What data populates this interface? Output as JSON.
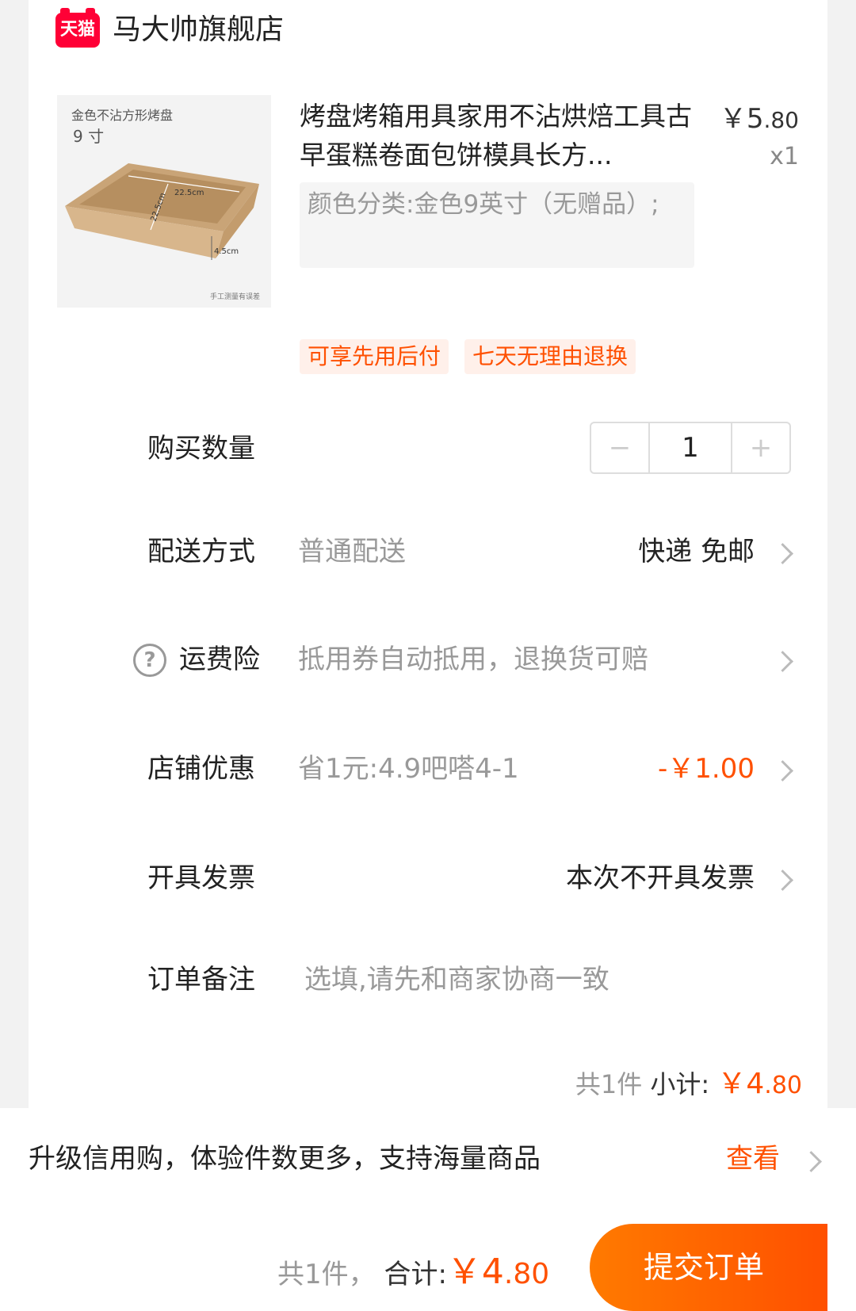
{
  "shop": {
    "logo_text": "天猫",
    "name": "马大帅旗舰店"
  },
  "product": {
    "image_caption": "金色不沾方形烤盘",
    "image_size_label": "9 寸",
    "image_dim_width": "22.5cm",
    "image_dim_depth": "22.5cm",
    "image_dim_height": "4.5cm",
    "image_note": "手工测量有误差",
    "title": "烤盘烤箱用具家用不沾烘焙工具古早蛋糕卷面包饼模具长方...",
    "price_symbol": "￥",
    "price_int": "5",
    "price_dec": ".80",
    "quantity_text": "x1",
    "sku": "颜色分类:金色9英寸（无赠品）;",
    "tags": [
      "可享先用后付",
      "七天无理由退换"
    ]
  },
  "rows": {
    "quantity": {
      "label": "购买数量",
      "value": "1",
      "minus": "−",
      "plus": "+"
    },
    "delivery": {
      "label": "配送方式",
      "method": "普通配送",
      "value": "快递 免邮"
    },
    "insurance": {
      "label": "运费险",
      "value": "抵用券自动抵用，退换货可赔",
      "help": "?"
    },
    "discount": {
      "label": "店铺优惠",
      "desc": "省1元:4.9吧嗒4-1",
      "value": "-￥1.00"
    },
    "invoice": {
      "label": "开具发票",
      "value": "本次不开具发票"
    },
    "note": {
      "label": "订单备注",
      "placeholder": "选填,请先和商家协商一致"
    }
  },
  "subtotal": {
    "count": "共1件",
    "label": "小计:",
    "symbol": "￥",
    "int": "4",
    "dec": ".80"
  },
  "credit": {
    "text": "升级信用购，体验件数更多，支持海量商品",
    "link": "查看"
  },
  "footer": {
    "count": "共1件，",
    "label": "合计:",
    "symbol": "￥",
    "int": "4",
    "dec": ".80",
    "submit": "提交订单"
  },
  "colors": {
    "accent": "#ff5000",
    "tmall_red": "#ff0036"
  }
}
